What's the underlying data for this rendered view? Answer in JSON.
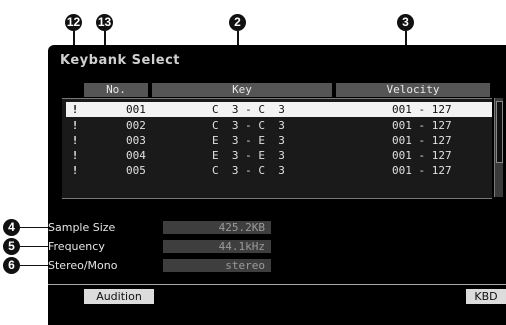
{
  "callouts": {
    "c12": "12",
    "c13": "13",
    "c2": "2",
    "c3": "3",
    "c4": "4",
    "c5": "5",
    "c6": "6"
  },
  "screen": {
    "title": "Keybank Select",
    "headers": {
      "no": "No.",
      "key": "Key",
      "velocity": "Velocity"
    },
    "rows": [
      {
        "mark": "!",
        "no": "001",
        "key": "C  3 - C  3",
        "velocity": "001 - 127"
      },
      {
        "mark": "!",
        "no": "002",
        "key": "C  3 - C  3",
        "velocity": "001 - 127"
      },
      {
        "mark": "!",
        "no": "003",
        "key": "E  3 - E  3",
        "velocity": "001 - 127"
      },
      {
        "mark": "!",
        "no": "004",
        "key": "E  3 - E  3",
        "velocity": "001 - 127"
      },
      {
        "mark": "!",
        "no": "005",
        "key": "C  3 - C  3",
        "velocity": "001 - 127"
      }
    ],
    "info": {
      "sample_size_label": "Sample Size",
      "sample_size_value": "425.2KB",
      "frequency_label": "Frequency",
      "frequency_value": "44.1kHz",
      "stereo_mono_label": "Stereo/Mono",
      "stereo_mono_value": "stereo"
    },
    "softkeys": {
      "audition": "Audition",
      "kbd": "KBD"
    }
  }
}
